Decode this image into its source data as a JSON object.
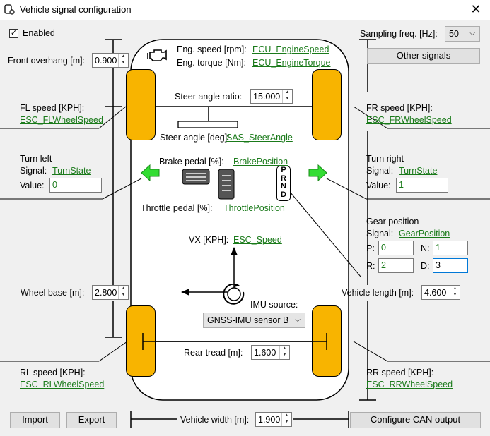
{
  "window": {
    "title": "Vehicle signal configuration",
    "close_glyph": "✕"
  },
  "enabled": {
    "label": "Enabled",
    "checked": true
  },
  "front_overhang": {
    "label": "Front overhang [m]:",
    "value": "0.900"
  },
  "sampling": {
    "label": "Sampling freq. [Hz]:",
    "value": "50"
  },
  "other_signals": "Other signals",
  "engine": {
    "speed_label": "Eng. speed [rpm]:",
    "speed_signal": "ECU_EngineSpeed",
    "torque_label": "Eng. torque [Nm]:",
    "torque_signal": "ECU_EngineTorque"
  },
  "steer_ratio": {
    "label": "Steer angle ratio:",
    "value": "15.000"
  },
  "steer_angle": {
    "label": "Steer angle [deg]:",
    "signal": "SAS_SteerAngle"
  },
  "fl_speed": {
    "label": "FL speed [KPH]:",
    "signal": "ESC_FLWheelSpeed"
  },
  "fr_speed": {
    "label": "FR speed [KPH]:",
    "signal": "ESC_FRWheelSpeed"
  },
  "rl_speed": {
    "label": "RL speed [KPH]:",
    "signal": "ESC_RLWheelSpeed"
  },
  "rr_speed": {
    "label": "RR speed [KPH]:",
    "signal": "ESC_RRWheelSpeed"
  },
  "turn_left": {
    "title": "Turn left",
    "signal_label": "Signal:",
    "signal": "TurnState",
    "value_label": "Value:",
    "value": "0"
  },
  "turn_right": {
    "title": "Turn right",
    "signal_label": "Signal:",
    "signal": "TurnState",
    "value_label": "Value:",
    "value": "1"
  },
  "brake": {
    "label": "Brake pedal [%]:",
    "signal": "BrakePosition"
  },
  "throttle": {
    "label": "Throttle pedal [%]:",
    "signal": "ThrottlePosition"
  },
  "gear_letters": [
    "P",
    "R",
    "N",
    "D"
  ],
  "gear": {
    "title": "Gear position",
    "signal_label": "Signal:",
    "signal": "GearPosition",
    "p_label": "P:",
    "p": "0",
    "n_label": "N:",
    "n": "1",
    "r_label": "R:",
    "r": "2",
    "d_label": "D:",
    "d": "3"
  },
  "vx": {
    "label": "VX [KPH]:",
    "signal": "ESC_Speed"
  },
  "wheel_base": {
    "label": "Wheel base [m]:",
    "value": "2.800"
  },
  "vehicle_length": {
    "label": "Vehicle length [m]:",
    "value": "4.600"
  },
  "imu": {
    "label": "IMU source:",
    "value": "GNSS-IMU sensor B"
  },
  "rear_tread": {
    "label": "Rear tread [m]:",
    "value": "1.600"
  },
  "vehicle_width": {
    "label": "Vehicle width [m]:",
    "value": "1.900"
  },
  "buttons": {
    "import": "Import",
    "export": "Export",
    "configure_can": "Configure CAN output"
  },
  "colors": {
    "wheel": "#f8b400",
    "arrow": "#33dd33",
    "link": "#1a7a1a",
    "focus": "#0078d7"
  },
  "icons": [
    "app-icon",
    "engine-icon",
    "brake-pedal-icon",
    "throttle-pedal-icon",
    "left-arrow-icon",
    "right-arrow-icon",
    "rotation-icon"
  ]
}
